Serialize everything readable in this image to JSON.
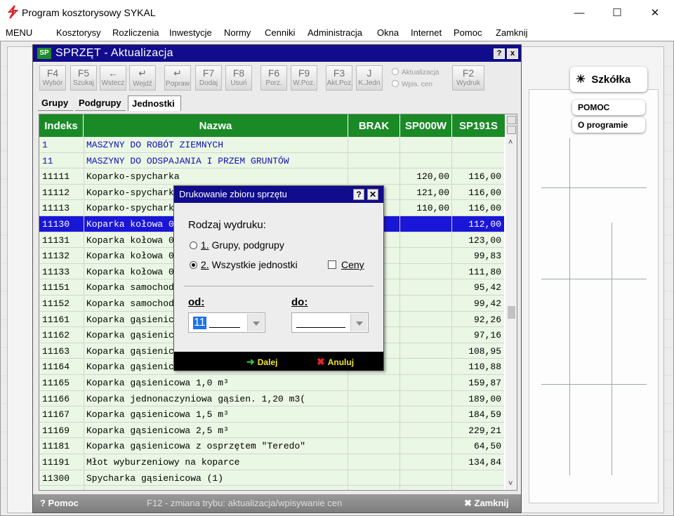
{
  "window": {
    "title": "Program kosztorysowy SYKAL"
  },
  "menu": [
    "MENU",
    "Kosztorysy",
    "Rozliczenia",
    "Inwestycje",
    "Normy",
    "Cenniki",
    "Administracja",
    "Okna",
    "Internet",
    "Pomoc",
    "Zamknij"
  ],
  "background_panel": {
    "szkolka": "Szkółka",
    "pomoc": "POMOC",
    "o_programie": "O programie"
  },
  "main_window": {
    "icon_text": "SP",
    "title": "SPRZĘT - Aktualizacja",
    "help_btn": "?",
    "close_btn": "x",
    "toolbar": [
      {
        "key": "F4",
        "label": "Wybór"
      },
      {
        "key": "F5",
        "label": "Szukaj"
      },
      {
        "key": "←",
        "label": "Wstecz"
      },
      {
        "key": "↵",
        "label": "Wejdź"
      },
      {
        "key": "↵",
        "label": "Popraw"
      },
      {
        "key": "F7",
        "label": "Dodaj"
      },
      {
        "key": "F8",
        "label": "Usuń"
      },
      {
        "key": "F6",
        "label": "Porz."
      },
      {
        "key": "F9",
        "label": "W.Poz."
      },
      {
        "key": "F3",
        "label": "Akt.Poz"
      },
      {
        "key": "J",
        "label": "K.Jedn"
      },
      {
        "key": "F2",
        "label": "Wydruk"
      }
    ],
    "mode_options": {
      "aktualizacja": "Aktualizacja",
      "wpis_cen": "Wpis. cen"
    },
    "tabs": [
      "Grupy",
      "Podgrupy",
      "Jednostki"
    ],
    "columns": [
      "Indeks",
      "Nazwa",
      "BRAK",
      "SP000W",
      "SP191S"
    ],
    "rows": [
      {
        "idx": "1",
        "name": "MASZYNY DO ROBÓT ZIEMNYCH",
        "sp0": "",
        "sp1": "",
        "group": true
      },
      {
        "idx": "11",
        "name": "MASZYNY DO ODSPAJANIA I PRZEM GRUNTÓW",
        "sp0": "",
        "sp1": "",
        "group": true
      },
      {
        "idx": "11111",
        "name": "Koparko-spycharka",
        "sp0": "120,00",
        "sp1": "116,00"
      },
      {
        "idx": "11112",
        "name": "Koparko-spycharka",
        "sp0": "121,00",
        "sp1": "116,00"
      },
      {
        "idx": "11113",
        "name": "Koparko-spycharka",
        "sp0": "110,00",
        "sp1": "116,00"
      },
      {
        "idx": "11130",
        "name": "Koparka kołowa 0",
        "sp0": "",
        "sp1": "112,00",
        "selected": true
      },
      {
        "idx": "11131",
        "name": "Koparka kołowa 0",
        "sp0": "",
        "sp1": "123,00"
      },
      {
        "idx": "11132",
        "name": "Koparka kołowa 0",
        "sp0": "",
        "sp1": "99,83"
      },
      {
        "idx": "11133",
        "name": "Koparka kołowa 0",
        "sp0": "",
        "sp1": "111,80"
      },
      {
        "idx": "11151",
        "name": "Koparka samochodowa",
        "sp0": "",
        "sp1": "95,42"
      },
      {
        "idx": "11152",
        "name": "Koparka samochodowa",
        "sp0": "",
        "sp1": "99,42"
      },
      {
        "idx": "11161",
        "name": "Koparka gąsienicowa",
        "sp0": "",
        "sp1": "92,26"
      },
      {
        "idx": "11162",
        "name": "Koparka gąsienicowa",
        "sp0": "",
        "sp1": "97,16"
      },
      {
        "idx": "11163",
        "name": "Koparka gąsienicowa",
        "sp0": "",
        "sp1": "108,95"
      },
      {
        "idx": "11164",
        "name": "Koparka gąsienicowa",
        "sp0": "",
        "sp1": "110,88"
      },
      {
        "idx": "11165",
        "name": "Koparka gąsienicowa 1,0 m³",
        "sp0": "",
        "sp1": "159,87"
      },
      {
        "idx": "11166",
        "name": "Koparka jednonaczyniowa gąsien. 1,20 m3(",
        "sp0": "",
        "sp1": "189,00"
      },
      {
        "idx": "11167",
        "name": "Koparka gąsienicowa 1,5 m³",
        "sp0": "",
        "sp1": "184,59"
      },
      {
        "idx": "11169",
        "name": "Koparka gąsienicowa 2,5 m³",
        "sp0": "",
        "sp1": "229,21"
      },
      {
        "idx": "11181",
        "name": "Koparka gąsienicowa z osprzętem \"Teredo\"",
        "sp0": "",
        "sp1": "64,50"
      },
      {
        "idx": "11191",
        "name": "Młot wyburzeniowy na koparce",
        "sp0": "",
        "sp1": "134,84"
      },
      {
        "idx": "11300",
        "name": "Spycharka gąsienicowa (1)",
        "sp0": "",
        "sp1": ""
      }
    ],
    "status": {
      "help": "? Pomoc",
      "hint": "F12 - zmiana trybu: aktualizacja/wpisywanie cen",
      "close": "✖ Zamknij"
    }
  },
  "dialog": {
    "title": "Drukowanie zbioru sprzętu",
    "help_btn": "?",
    "close_btn": "✕",
    "group_label": "Rodzaj wydruku:",
    "option1_num": "1.",
    "option1_text": " Grupy, podgrupy",
    "option2_num": "2.",
    "option2_text": " Wszystkie jednostki",
    "ceny_label": "Ceny",
    "od_label": "od:",
    "do_label": "do:",
    "od_value": "11",
    "do_value": "",
    "next_btn": "Dalej",
    "cancel_btn": "Anuluj"
  },
  "colors": {
    "title_blue": "#100c8c",
    "header_green": "#1a8a26",
    "grid_bg": "#eaf7e4",
    "selected": "#1a16d8",
    "group_text": "#1010b8"
  }
}
